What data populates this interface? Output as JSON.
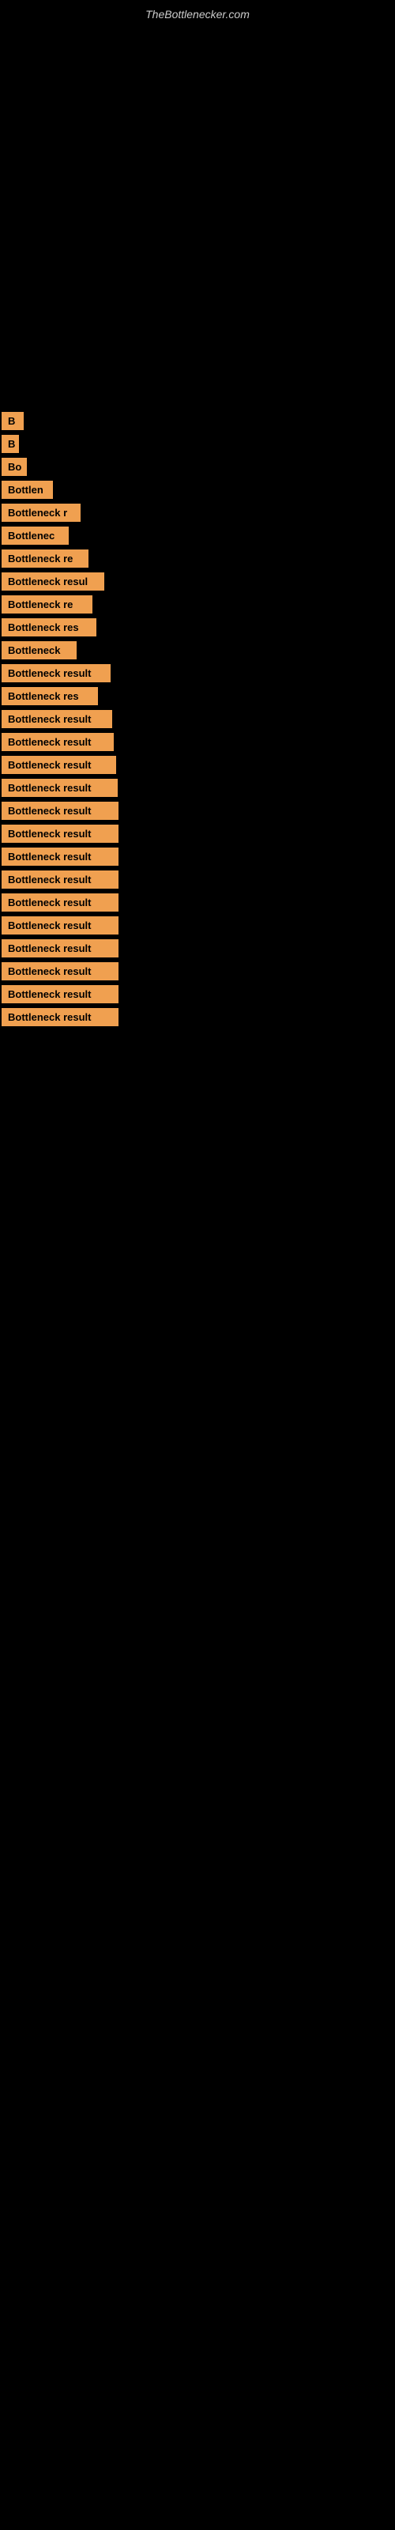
{
  "site": {
    "title": "TheBottlenecker.com"
  },
  "items": [
    {
      "label": "B",
      "width": 28
    },
    {
      "label": "B",
      "width": 22
    },
    {
      "label": "Bo",
      "width": 32
    },
    {
      "label": "Bottlen",
      "width": 65
    },
    {
      "label": "Bottleneck r",
      "width": 100
    },
    {
      "label": "Bottlenec",
      "width": 85
    },
    {
      "label": "Bottleneck re",
      "width": 110
    },
    {
      "label": "Bottleneck resul",
      "width": 130
    },
    {
      "label": "Bottleneck re",
      "width": 115
    },
    {
      "label": "Bottleneck res",
      "width": 120
    },
    {
      "label": "Bottleneck",
      "width": 95
    },
    {
      "label": "Bottleneck result",
      "width": 138
    },
    {
      "label": "Bottleneck res",
      "width": 122
    },
    {
      "label": "Bottleneck result",
      "width": 140
    },
    {
      "label": "Bottleneck result",
      "width": 142
    },
    {
      "label": "Bottleneck result",
      "width": 145
    },
    {
      "label": "Bottleneck result",
      "width": 147
    },
    {
      "label": "Bottleneck result",
      "width": 148
    },
    {
      "label": "Bottleneck result",
      "width": 148
    },
    {
      "label": "Bottleneck result",
      "width": 148
    },
    {
      "label": "Bottleneck result",
      "width": 148
    },
    {
      "label": "Bottleneck result",
      "width": 148
    },
    {
      "label": "Bottleneck result",
      "width": 148
    },
    {
      "label": "Bottleneck result",
      "width": 148
    },
    {
      "label": "Bottleneck result",
      "width": 148
    },
    {
      "label": "Bottleneck result",
      "width": 148
    },
    {
      "label": "Bottleneck result",
      "width": 148
    }
  ]
}
